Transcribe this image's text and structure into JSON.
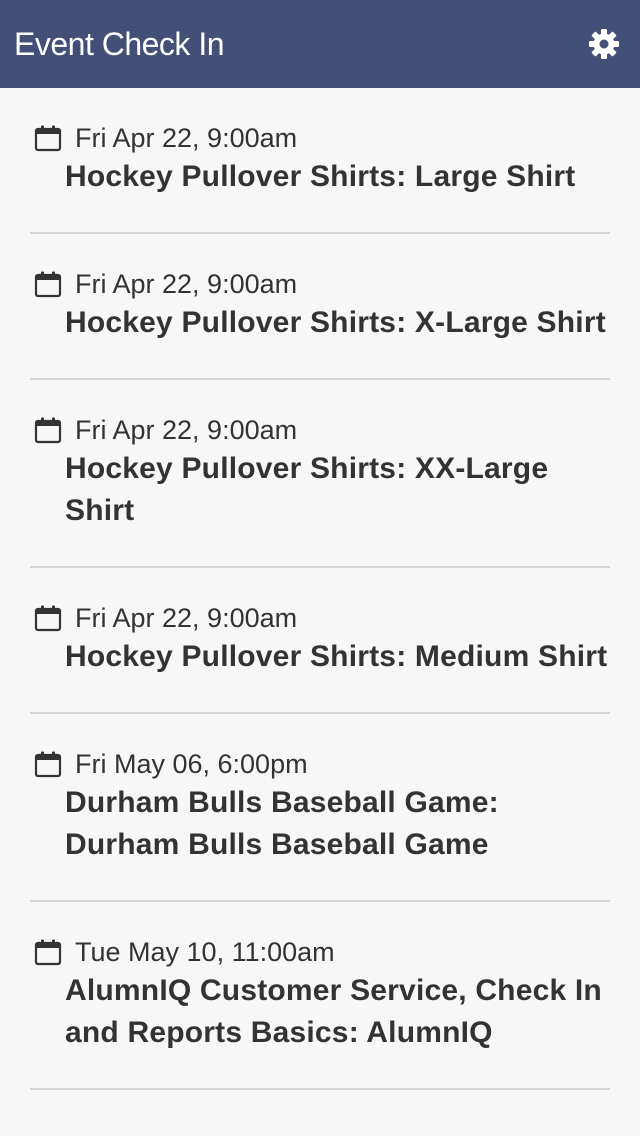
{
  "header": {
    "title": "Event Check In",
    "settings_icon": "gear-icon"
  },
  "events": [
    {
      "date": "Fri Apr 22, 9:00am",
      "title": "Hockey Pullover Shirts: Large Shirt"
    },
    {
      "date": "Fri Apr 22, 9:00am",
      "title": "Hockey Pullover Shirts: X-Large Shirt"
    },
    {
      "date": "Fri Apr 22, 9:00am",
      "title": "Hockey Pullover Shirts: XX-Large Shirt"
    },
    {
      "date": "Fri Apr 22, 9:00am",
      "title": "Hockey Pullover Shirts: Medium Shirt"
    },
    {
      "date": "Fri May 06, 6:00pm",
      "title": "Durham Bulls Baseball Game: Durham Bulls Baseball Game"
    },
    {
      "date": "Tue May 10, 11:00am",
      "title": "AlumnIQ Customer Service, Check In and Reports Basics: AlumnIQ"
    }
  ],
  "colors": {
    "header_bg": "#425077",
    "page_bg": "#f7f7f7",
    "text": "#333333",
    "divider": "#d6d6d6"
  }
}
